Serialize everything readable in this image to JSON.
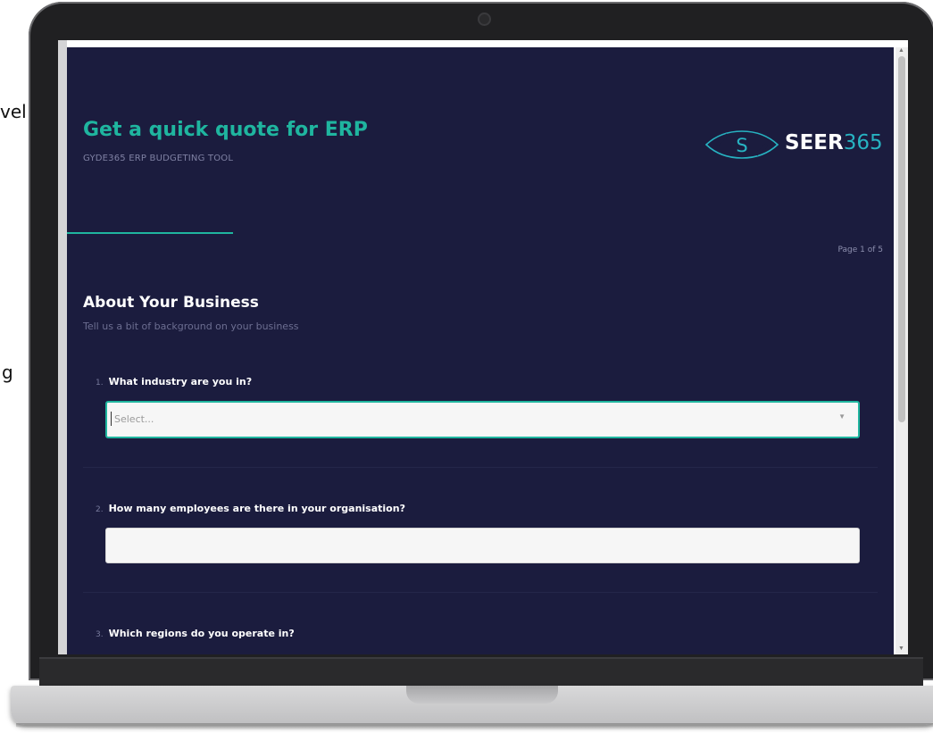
{
  "background": {
    "fragment_top": "vel",
    "fragment_mid": "g"
  },
  "page": {
    "title": "Get a quick quote for ERP",
    "subtitle": "GYDE365 ERP BUDGETING TOOL",
    "logo": {
      "word": "SEER",
      "number": "365",
      "mark_letter": "S"
    },
    "page_indicator": "Page 1 of 5",
    "progress_fraction": 0.2
  },
  "section": {
    "title": "About Your Business",
    "description": "Tell us a bit of background on your business"
  },
  "questions": [
    {
      "number": "1.",
      "label": "What industry are you in?",
      "type": "select",
      "placeholder": "Select..."
    },
    {
      "number": "2.",
      "label": "How many employees are there in your organisation?",
      "type": "text",
      "value": ""
    },
    {
      "number": "3.",
      "label": "Which regions do you operate in?",
      "type": "multiselect"
    }
  ],
  "colors": {
    "accent": "#1fb59f",
    "background": "#1b1c3e",
    "logo_number": "#27b3c2"
  }
}
